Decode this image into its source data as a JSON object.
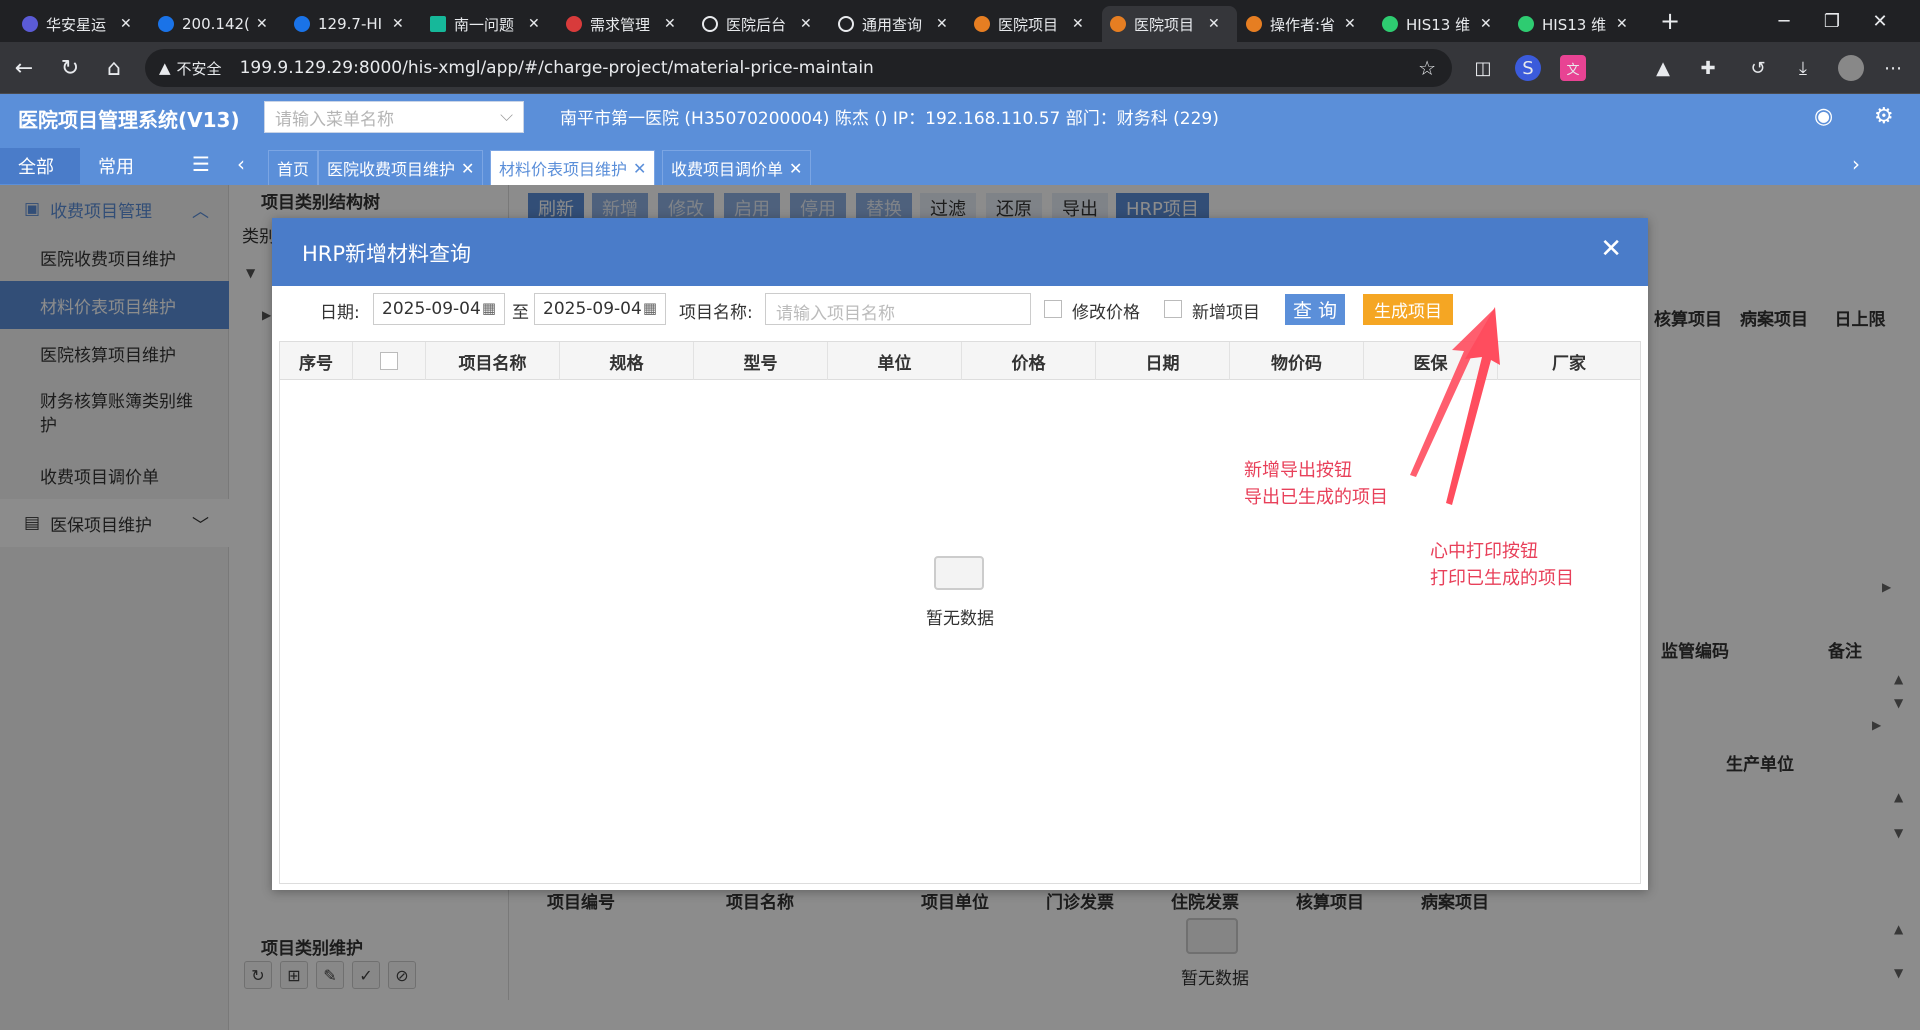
{
  "browser": {
    "tabs": [
      {
        "title": "华安星运"
      },
      {
        "title": "200.142("
      },
      {
        "title": "129.7-HI"
      },
      {
        "title": "南一问题"
      },
      {
        "title": "需求管理"
      },
      {
        "title": "医院后台"
      },
      {
        "title": "通用查询"
      },
      {
        "title": "医院项目"
      },
      {
        "title": "医院项目"
      },
      {
        "title": "操作者:省"
      },
      {
        "title": "HIS13 维"
      },
      {
        "title": "HIS13 维"
      }
    ],
    "new_tab": "+",
    "insecure_label": "不安全",
    "url": "199.9.129.29:8000/his-xmgl/app/#/charge-project/material-price-maintain"
  },
  "app": {
    "title": "医院项目管理系统(V13)",
    "menu_search_placeholder": "请输入菜单名称",
    "user_info": "南平市第一医院 (H35070200004) 陈杰 () IP：192.168.110.57 部门：财务科 (229)",
    "left_tabs": [
      "全部",
      "常用"
    ],
    "page_tabs": [
      "首页",
      "医院收费项目维护",
      "材料价表项目维护",
      "收费项目调价单"
    ]
  },
  "sidebar": {
    "group1": "收费项目管理",
    "items": [
      "医院收费项目维护",
      "材料价表项目维护",
      "医院核算项目维护",
      "财务核算账簿类别维护",
      "收费项目调价单"
    ],
    "group2": "医保项目维护"
  },
  "background": {
    "tree_title": "项目类别结构树",
    "tree_label": "类别",
    "toolbar": [
      "刷新",
      "新增",
      "修改",
      "启用",
      "停用",
      "替换",
      "过滤",
      "还原",
      "导出",
      "HRP项目"
    ],
    "right_headers_1": [
      "核算项目",
      "病案项目",
      "日上限"
    ],
    "right_headers_2": [
      "监管编码",
      "备注"
    ],
    "right_headers_3": [
      "生产单位"
    ],
    "bottom_headers": [
      "项目编号",
      "项目名称",
      "项目单位",
      "门诊发票",
      "住院发票",
      "核算项目",
      "病案项目"
    ],
    "bottom_empty": "暂无数据",
    "category_title": "项目类别维护"
  },
  "dialog": {
    "title": "HRP新增材料查询",
    "date_label": "日期:",
    "date_from": "2025-09-04",
    "to_label": "至",
    "date_to": "2025-09-04",
    "name_label": "项目名称:",
    "name_placeholder": "请输入项目名称",
    "chk_modify": "修改价格",
    "chk_new": "新增项目",
    "query_btn": "查 询",
    "generate_btn": "生成项目",
    "columns": [
      "序号",
      "",
      "项目名称",
      "规格",
      "型号",
      "单位",
      "价格",
      "日期",
      "物价码",
      "医保",
      "厂家"
    ],
    "empty": "暂无数据"
  },
  "annotations": {
    "note1_line1": "新增导出按钮",
    "note1_line2": "导出已生成的项目",
    "note2_line1": "心中打印按钮",
    "note2_line2": "打印已生成的项目",
    "color": "#e8405a"
  },
  "colors": {
    "primary": "#5b8fd9",
    "dialog_header": "#4a7cc9",
    "generate": "#f5a623"
  }
}
